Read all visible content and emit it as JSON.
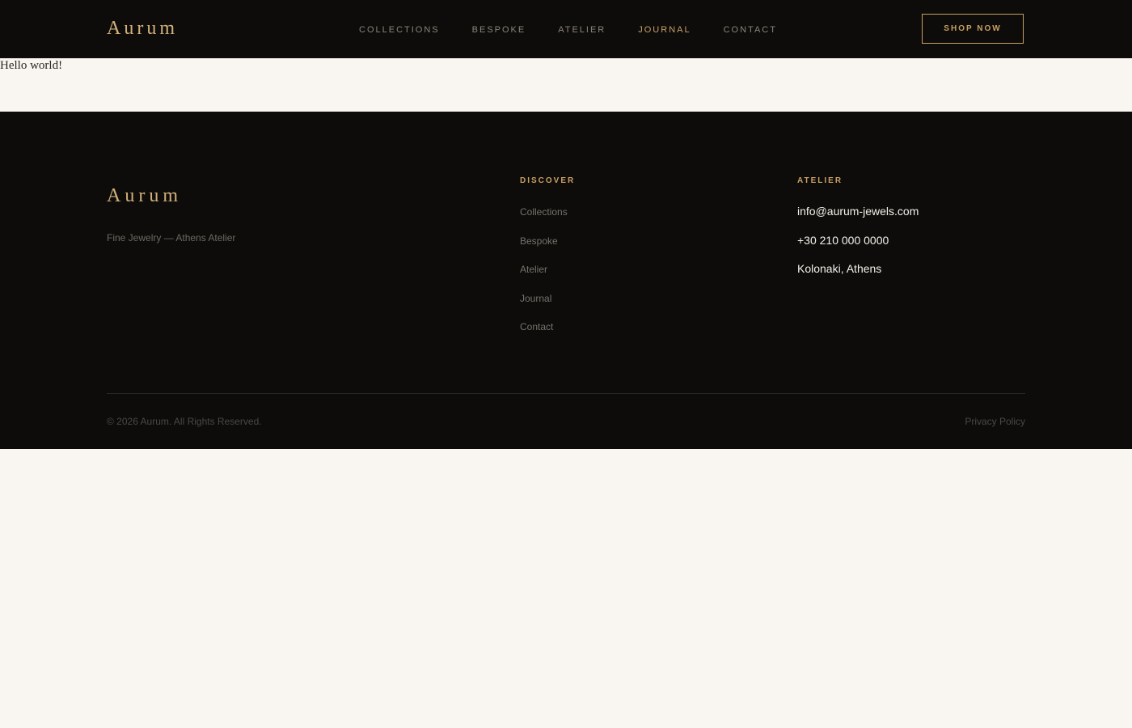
{
  "header": {
    "logo": "Aurum",
    "nav": [
      {
        "label": "COLLECTIONS",
        "active": false
      },
      {
        "label": "BESPOKE",
        "active": false
      },
      {
        "label": "ATELIER",
        "active": false
      },
      {
        "label": "JOURNAL",
        "active": true
      },
      {
        "label": "CONTACT",
        "active": false
      }
    ],
    "cta_label": "SHOP NOW"
  },
  "main": {
    "text": "Hello world!"
  },
  "footer": {
    "logo": "Aurum",
    "tagline": "Fine Jewelry — Athens Atelier",
    "discover": {
      "heading": "DISCOVER",
      "links": [
        "Collections",
        "Bespoke",
        "Atelier",
        "Journal",
        "Contact"
      ]
    },
    "atelier": {
      "heading": "ATELIER",
      "email": "info@aurum-jewels.com",
      "phone": "+30 210 000 0000",
      "address": "Kolonaki, Athens"
    },
    "copyright": "© 2026 Aurum. All Rights Reserved.",
    "privacy": "Privacy Policy"
  },
  "colors": {
    "background": "#f9f6f1",
    "dark": "#0d0c0b",
    "gold": "#c9a063",
    "logo_gold": "#d2b07a"
  }
}
